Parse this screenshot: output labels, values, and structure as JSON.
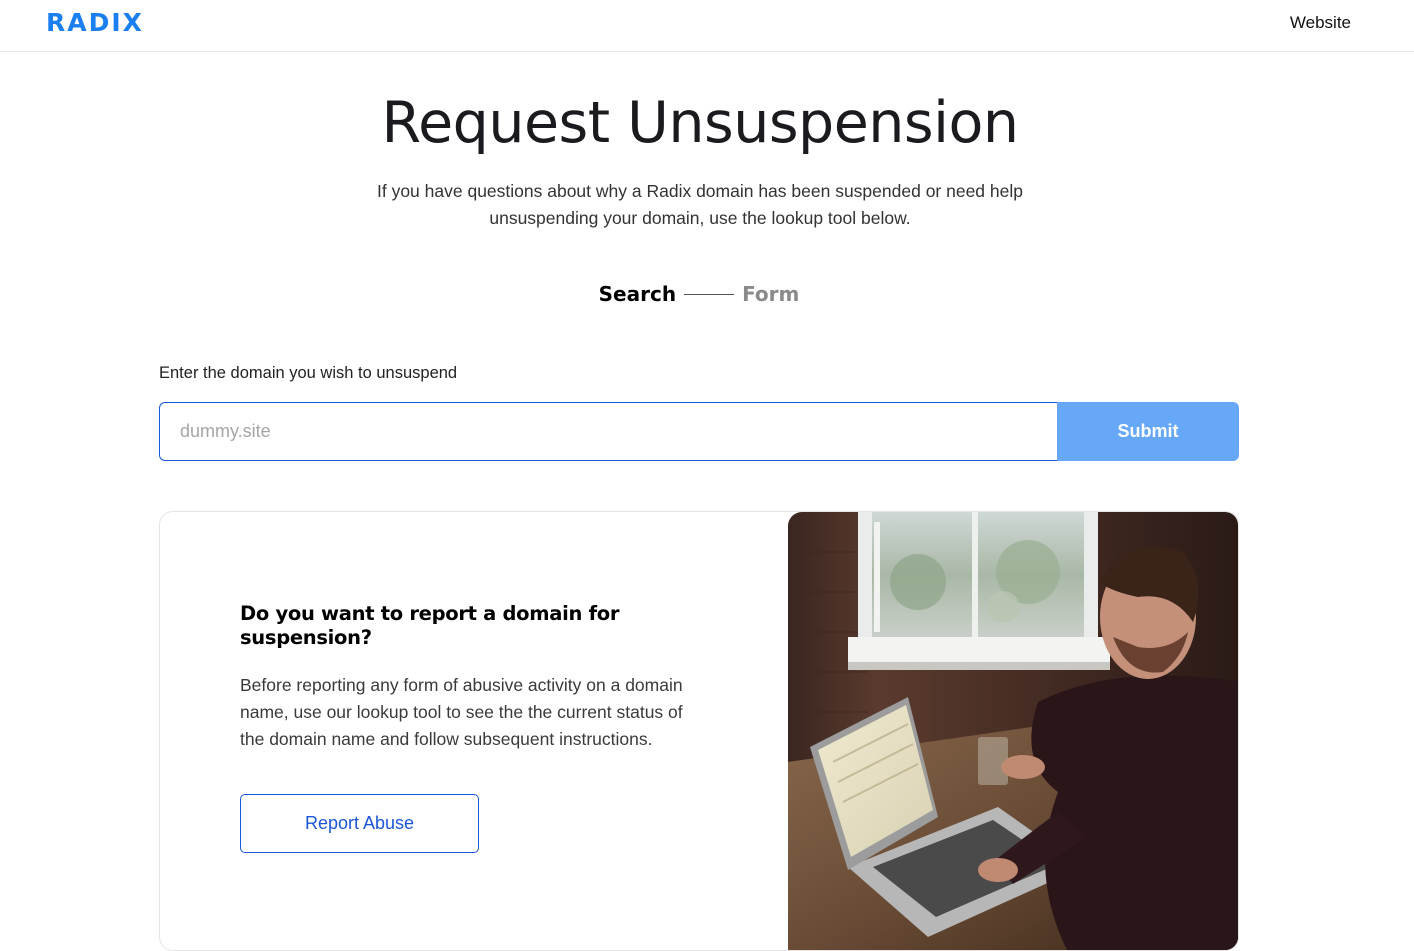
{
  "header": {
    "logo_text": "RADIX",
    "nav_link": "Website"
  },
  "hero": {
    "title": "Request Unsuspension",
    "intro": "If you have questions about why a Radix domain has been suspended or need help unsuspending your domain, use the lookup tool below."
  },
  "steps": [
    {
      "label": "Search",
      "active": true
    },
    {
      "label": "Form",
      "active": false
    }
  ],
  "search": {
    "label": "Enter the domain you wish to unsuspend",
    "placeholder": "dummy.site",
    "value": "",
    "submit_label": "Submit"
  },
  "report_card": {
    "heading": "Do you want to report a domain for suspension?",
    "body": "Before reporting any form of abusive activity on a domain name, use our lookup tool to see the the current status of the domain name and follow subsequent instructions.",
    "button_label": "Report Abuse",
    "image": "photo of a man typing on a laptop at a wooden table by a window"
  },
  "colors": {
    "brand": "#1a7ff0",
    "primary": "#1a56d6",
    "submit_bg": "#66a8f7"
  }
}
